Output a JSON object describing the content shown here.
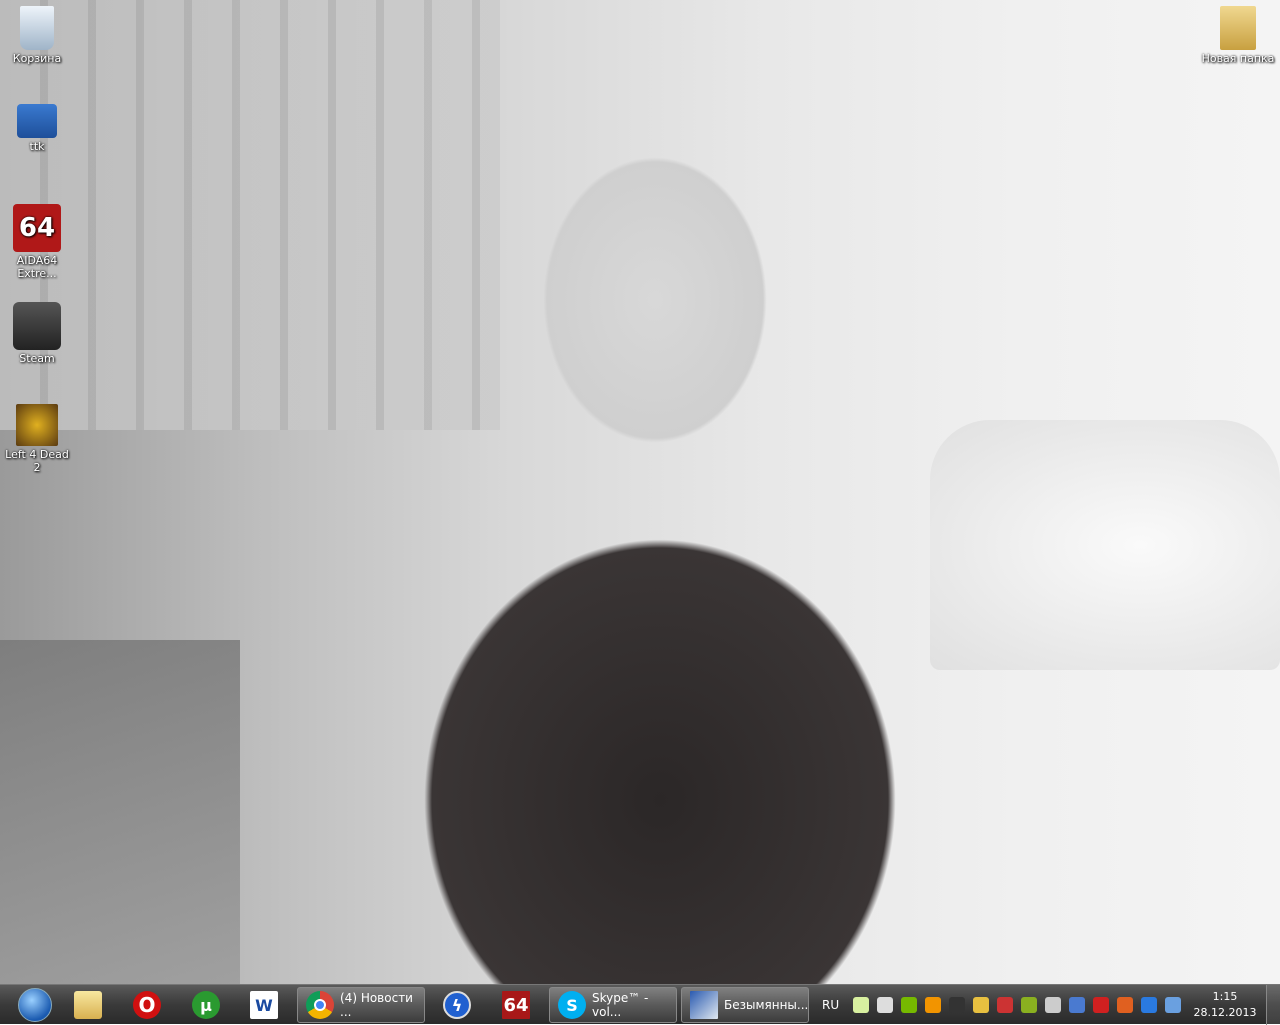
{
  "desktop": {
    "icons": [
      {
        "label": "Корзина",
        "icon": "recycle-bin-icon"
      },
      {
        "label": "ttk",
        "icon": "network-computer-icon"
      },
      {
        "label": "AIDA64 Extre...",
        "icon": "aida64-icon",
        "glyph": "64"
      },
      {
        "label": "Steam",
        "icon": "steam-icon"
      },
      {
        "label": "Left 4 Dead 2",
        "icon": "left4dead2-icon"
      },
      {
        "label": "Новая папка",
        "icon": "folder-icon"
      }
    ]
  },
  "taskbar": {
    "pinned": [
      {
        "name": "windows-explorer"
      },
      {
        "name": "opera",
        "glyph": "O"
      },
      {
        "name": "utorrent",
        "glyph": "µ"
      },
      {
        "name": "word",
        "glyph": "W"
      },
      {
        "name": "daemon-tools",
        "glyph": "ϟ"
      },
      {
        "name": "aida64",
        "glyph": "64"
      }
    ],
    "tasks": [
      {
        "label": "(4) Новости ..."
      },
      {
        "label": "Skype™ - vol..."
      },
      {
        "label": "Безымянны..."
      }
    ],
    "skype_glyph": "S",
    "language": "RU",
    "clock": {
      "time": "1:15",
      "date": "28.12.2013"
    },
    "tray_colors": [
      "#d8f0a0",
      "#dddddd",
      "#76b900",
      "#f29400",
      "#333333",
      "#e8c040",
      "#cc3333",
      "#8ab020",
      "#cccccc",
      "#4a7ad0",
      "#d02020",
      "#e06020",
      "#2a7ae0",
      "#6aa0e0"
    ]
  }
}
